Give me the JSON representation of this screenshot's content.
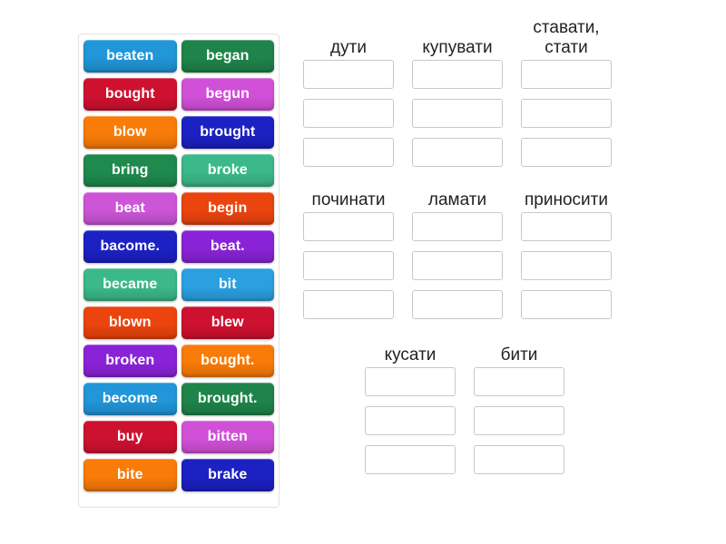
{
  "word_bank": {
    "name": "word-bank",
    "tiles": [
      {
        "label": "beaten",
        "color": "#2196d8"
      },
      {
        "label": "began",
        "color": "#1e8449"
      },
      {
        "label": "bought",
        "color": "#cf1130"
      },
      {
        "label": "begun",
        "color": "#d150d8"
      },
      {
        "label": "blow",
        "color": "#f97b08"
      },
      {
        "label": "brought",
        "color": "#1c21c4"
      },
      {
        "label": "bring",
        "color": "#1e8a4e"
      },
      {
        "label": "broke",
        "color": "#3bb98a"
      },
      {
        "label": "beat",
        "color": "#cc55d8"
      },
      {
        "label": "begin",
        "color": "#eb440e"
      },
      {
        "label": "bacome.",
        "color": "#1c21c4"
      },
      {
        "label": "beat.",
        "color": "#8a23d8"
      },
      {
        "label": "became",
        "color": "#3bb98a"
      },
      {
        "label": "bit",
        "color": "#2ba0e0"
      },
      {
        "label": "blown",
        "color": "#eb440e"
      },
      {
        "label": "blew",
        "color": "#cf1130"
      },
      {
        "label": "broken",
        "color": "#8a23d8"
      },
      {
        "label": "bought.",
        "color": "#f97b08"
      },
      {
        "label": "become",
        "color": "#2196d8"
      },
      {
        "label": "brought.",
        "color": "#1e8449"
      },
      {
        "label": "buy",
        "color": "#cf1130"
      },
      {
        "label": "bitten",
        "color": "#d150d8"
      },
      {
        "label": "bite",
        "color": "#f97b08"
      },
      {
        "label": "brake",
        "color": "#1c21c4"
      }
    ]
  },
  "drop_area": {
    "rows": [
      {
        "columns": [
          {
            "title": "дути",
            "slots": [
              "",
              "",
              ""
            ]
          },
          {
            "title": "купувати",
            "slots": [
              "",
              "",
              ""
            ]
          },
          {
            "title": "ставати,\nстати",
            "slots": [
              "",
              "",
              ""
            ]
          }
        ]
      },
      {
        "columns": [
          {
            "title": "починати",
            "slots": [
              "",
              "",
              ""
            ]
          },
          {
            "title": "ламати",
            "slots": [
              "",
              "",
              ""
            ]
          },
          {
            "title": "приносити",
            "slots": [
              "",
              "",
              ""
            ]
          }
        ]
      },
      {
        "columns": [
          {
            "title": "кусати",
            "slots": [
              "",
              "",
              ""
            ]
          },
          {
            "title": "бити",
            "slots": [
              "",
              "",
              ""
            ]
          }
        ]
      }
    ]
  }
}
